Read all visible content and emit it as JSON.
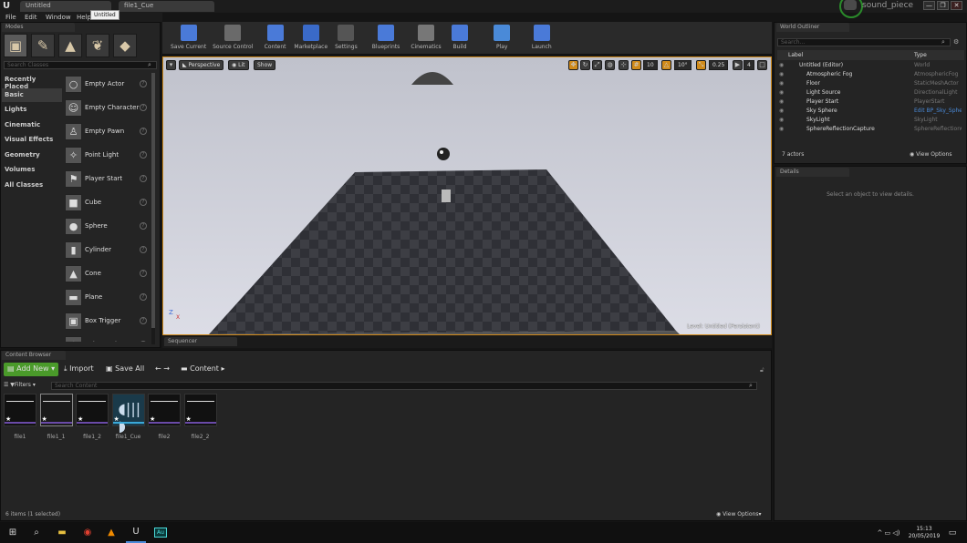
{
  "window": {
    "tab_main": "Untitled",
    "tab_cue": "file1_Cue",
    "tooltip": "Untitled",
    "project": "sound_piece",
    "min": "—",
    "max": "❐",
    "close": "✕"
  },
  "menu": [
    "File",
    "Edit",
    "Window",
    "Help"
  ],
  "modes": {
    "tab": "Modes",
    "search_placeholder": "Search Classes",
    "categories": [
      "Recently Placed",
      "Basic",
      "Lights",
      "Cinematic",
      "Visual Effects",
      "Geometry",
      "Volumes",
      "All Classes"
    ],
    "selected_category": "Basic",
    "items": [
      "Empty Actor",
      "Empty Character",
      "Empty Pawn",
      "Point Light",
      "Player Start",
      "Cube",
      "Sphere",
      "Cylinder",
      "Cone",
      "Plane",
      "Box Trigger",
      "Sphere Trigger"
    ]
  },
  "toolbar": [
    "Save Current",
    "Source Control",
    "Content",
    "Marketplace",
    "Settings",
    "Blueprints",
    "Cinematics",
    "Build",
    "Play",
    "Launch"
  ],
  "viewport": {
    "perspective": "Perspective",
    "lit": "Lit",
    "show": "Show",
    "grid": "10",
    "angle": "10°",
    "scale": "0.25",
    "cam": "4",
    "level_label": "Level:",
    "level_name": "Untitled (Persistent)",
    "axis_z": "Z",
    "axis_x": "X",
    "axis_y": "Y"
  },
  "sequencer": {
    "tab": "Sequencer"
  },
  "outliner": {
    "tab": "World Outliner",
    "search_placeholder": "Search...",
    "col_label": "Label",
    "col_type": "Type",
    "rows": [
      {
        "label": "Untitled (Editor)",
        "type": "World"
      },
      {
        "label": "Atmospheric Fog",
        "type": "AtmosphericFog"
      },
      {
        "label": "Floor",
        "type": "StaticMeshActor"
      },
      {
        "label": "Light Source",
        "type": "DirectionalLight"
      },
      {
        "label": "Player Start",
        "type": "PlayerStart"
      },
      {
        "label": "Sky Sphere",
        "type": "Edit BP_Sky_Sphe"
      },
      {
        "label": "SkyLight",
        "type": "SkyLight"
      },
      {
        "label": "SphereReflectionCapture",
        "type": "SphereReflectionC"
      }
    ],
    "count": "7 actors",
    "view_options": "View Options"
  },
  "details": {
    "tab": "Details",
    "empty": "Select an object to view details."
  },
  "content_browser": {
    "tab": "Content Browser",
    "add_new": "Add New",
    "import": "Import",
    "save_all": "Save All",
    "path": "Content",
    "filters": "Filters",
    "search_placeholder": "Search Content",
    "assets": [
      "file1",
      "file1_1",
      "file1_2",
      "file1_Cue",
      "file2",
      "file2_2"
    ],
    "status": "6 items (1 selected)",
    "view_options": "View Options"
  },
  "taskbar": {
    "time": "15:13",
    "date": "20/05/2019",
    "ae": "Au"
  },
  "colors": {
    "accent_green": "#4a9a2a",
    "selection_orange": "#d08a1a",
    "link_blue": "#4a8ad8"
  }
}
